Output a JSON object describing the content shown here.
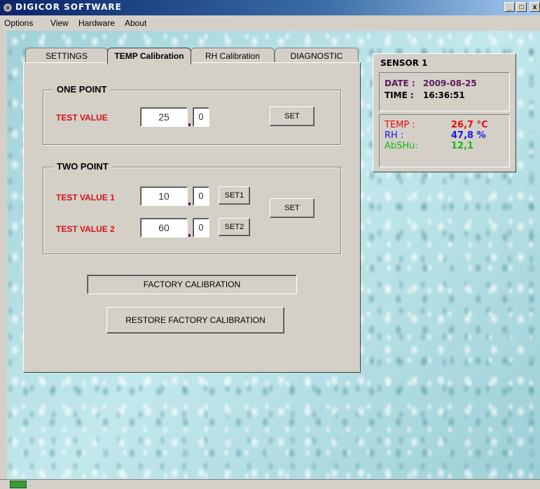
{
  "window": {
    "title": "DIGICOR SOFTWARE",
    "buttons": [
      "_",
      "□",
      "x"
    ]
  },
  "menu": {
    "items": [
      "Options",
      "View",
      "Hardware",
      "About"
    ]
  },
  "tabs": [
    {
      "label": "SETTINGS"
    },
    {
      "label": "TEMP Calibration"
    },
    {
      "label": "RH Calibration"
    },
    {
      "label": "DIAGNOSTIC"
    }
  ],
  "active_tab": "TEMP Calibration",
  "one_point": {
    "title": "ONE POINT",
    "test_label": "TEST VALUE",
    "value_int": "25",
    "value_dec": "0",
    "set_label": "SET"
  },
  "two_point": {
    "title": "TWO  POINT",
    "test1_label": "TEST VALUE 1",
    "value1_int": "10",
    "value1_dec": "0",
    "set1_label": "SET1",
    "test2_label": "TEST VALUE 2",
    "value2_int": "60",
    "value2_dec": "0",
    "set2_label": "SET2",
    "set_label": "SET"
  },
  "factory": {
    "status_text": "FACTORY CALIBRATION",
    "restore_label": "RESTORE FACTORY CALIBRATION"
  },
  "sensor": {
    "title": "SENSOR 1",
    "date_label": "DATE :",
    "date_value": "2009-08-25",
    "time_label": "TIME :",
    "time_value": "16:36:51",
    "readings": [
      {
        "label": "TEMP :",
        "value": "26,7 °C",
        "color": "#e01010"
      },
      {
        "label": "RH    :",
        "value": "47,8 %",
        "color": "#1a1ae0"
      },
      {
        "label": "AbSHu:",
        "value": "12,1",
        "color": "#16b816"
      }
    ],
    "date_color": "#5a1a5a"
  }
}
